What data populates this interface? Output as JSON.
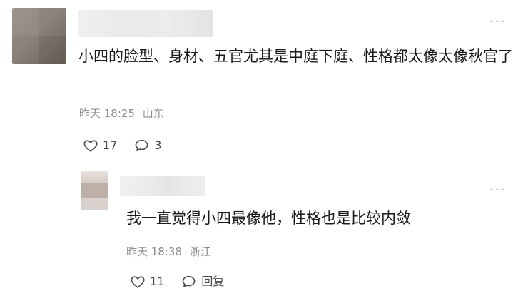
{
  "comment": {
    "text": "小四的脸型、身材、五官尤其是中庭下庭、性格都太像太像秋官了",
    "time": "昨天 18:25",
    "location": "山东",
    "likes": "17",
    "replies": "3",
    "more": "···"
  },
  "reply": {
    "text": "我一直觉得小四最像他，性格也是比较内敛",
    "time": "昨天 18:38",
    "location": "浙江",
    "likes": "11",
    "reply_label": "回复",
    "more": "···"
  },
  "icons": {
    "like": "heart-outline-icon",
    "comment": "speech-bubble-icon",
    "more": "ellipsis-icon"
  },
  "colors": {
    "text": "#1a1a1a",
    "meta": "#8e8e8e",
    "actions": "#4a4a4a",
    "background": "#ffffff"
  }
}
